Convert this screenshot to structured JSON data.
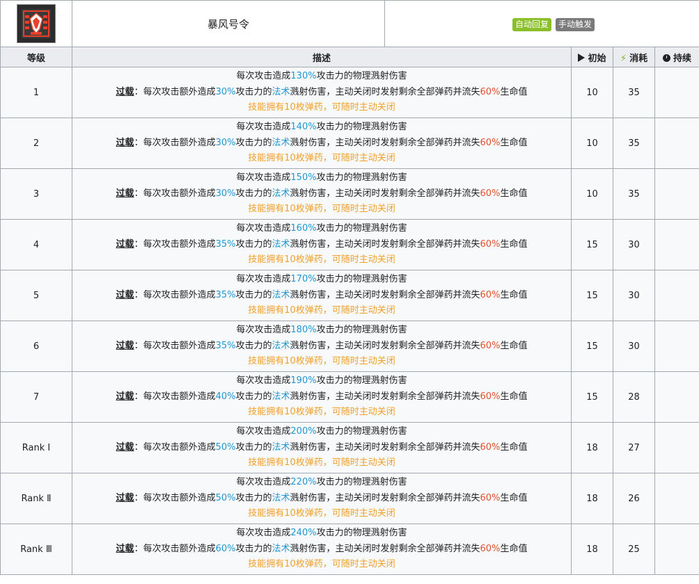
{
  "skill": {
    "name": "暴风号令",
    "icon": "storm-command-skill-icon",
    "tags": [
      "自动回复",
      "手动触发"
    ]
  },
  "headers": {
    "level": "等级",
    "desc": "描述",
    "initial": "初始",
    "cost": "消耗",
    "duration": "持续"
  },
  "rows": [
    {
      "level": "1",
      "atk": "130%",
      "magic": "30%",
      "initial": "10",
      "cost": "35",
      "duration": ""
    },
    {
      "level": "2",
      "atk": "140%",
      "magic": "30%",
      "initial": "10",
      "cost": "35",
      "duration": ""
    },
    {
      "level": "3",
      "atk": "150%",
      "magic": "30%",
      "initial": "10",
      "cost": "35",
      "duration": ""
    },
    {
      "level": "4",
      "atk": "160%",
      "magic": "35%",
      "initial": "15",
      "cost": "30",
      "duration": ""
    },
    {
      "level": "5",
      "atk": "170%",
      "magic": "35%",
      "initial": "15",
      "cost": "30",
      "duration": ""
    },
    {
      "level": "6",
      "atk": "180%",
      "magic": "35%",
      "initial": "15",
      "cost": "30",
      "duration": ""
    },
    {
      "level": "7",
      "atk": "190%",
      "magic": "40%",
      "initial": "15",
      "cost": "28",
      "duration": ""
    },
    {
      "level": "Rank Ⅰ",
      "atk": "200%",
      "magic": "50%",
      "initial": "18",
      "cost": "27",
      "duration": ""
    },
    {
      "level": "Rank Ⅱ",
      "atk": "220%",
      "magic": "50%",
      "initial": "18",
      "cost": "26",
      "duration": ""
    },
    {
      "level": "Rank Ⅲ",
      "atk": "240%",
      "magic": "60%",
      "initial": "18",
      "cost": "25",
      "duration": ""
    }
  ],
  "text": {
    "line1_pre": "每次攻击造成",
    "line1_post": "攻击力的物理溅射伤害",
    "overload": "过载",
    "line2_a": "：每次攻击额外造成",
    "line2_b": "攻击力的",
    "magic_word": "法术",
    "line2_c": "溅射伤害，主动关闭时发射剩余全部弹药并流失",
    "hp_loss": "60%",
    "line2_d": "生命值",
    "line3": "技能拥有10枚弹药，可随时主动关闭"
  },
  "colors": {
    "header_bg": "#eaecf0",
    "row_bg": "#f8f9fa",
    "border": "#a2a9b1",
    "blue": "#1f97d3",
    "red": "#e0502c",
    "orange": "#f0a02b",
    "tag_auto": "#8bbf2a",
    "tag_manual": "#7a7a7a"
  }
}
